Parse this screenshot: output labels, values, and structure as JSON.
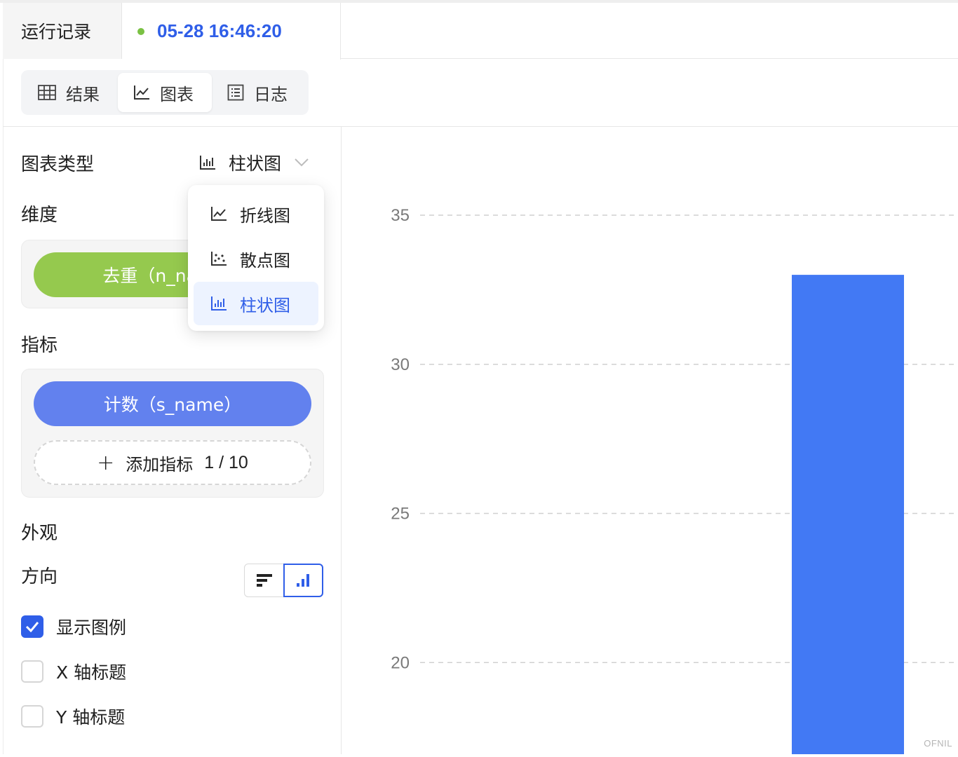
{
  "tabs": {
    "run_record": "运行记录",
    "run_time": "05-28 16:46:20",
    "status_color": "#7ac143"
  },
  "view_switch": {
    "items": [
      {
        "label": "结果",
        "icon": "table-icon"
      },
      {
        "label": "图表",
        "icon": "line-chart-icon",
        "active": true
      },
      {
        "label": "日志",
        "icon": "log-list-icon"
      }
    ]
  },
  "settings": {
    "chart_type_label": "图表类型",
    "chart_type_value": "柱状图",
    "dimension_label": "维度",
    "dimension_pill": "去重（n_name）",
    "metric_label": "指标",
    "metric_pill": "计数（s_name）",
    "add_metric": "添加指标",
    "metric_count": "1 / 10",
    "appearance_label": "外观",
    "direction_label": "方向",
    "direction_selected": "vertical",
    "checkboxes": [
      {
        "label": "显示图例",
        "checked": true
      },
      {
        "label": "X 轴标题",
        "checked": false
      },
      {
        "label": "Y 轴标题",
        "checked": false
      }
    ]
  },
  "dropdown": {
    "options": [
      {
        "label": "折线图",
        "icon": "line-chart-icon"
      },
      {
        "label": "散点图",
        "icon": "scatter-chart-icon"
      },
      {
        "label": "柱状图",
        "icon": "bar-chart-icon",
        "selected": true
      }
    ]
  },
  "colors": {
    "accent": "#2f5ee8",
    "bar": "#4279f4",
    "dimension_pill": "#95c94e",
    "metric_pill": "#6281ee"
  },
  "chart_data": {
    "type": "bar",
    "y_ticks": [
      20,
      25,
      30,
      35
    ],
    "ylim": [
      17,
      36
    ],
    "bars": [
      {
        "value": 33
      }
    ],
    "grid": true
  },
  "watermark": "OFNIL"
}
